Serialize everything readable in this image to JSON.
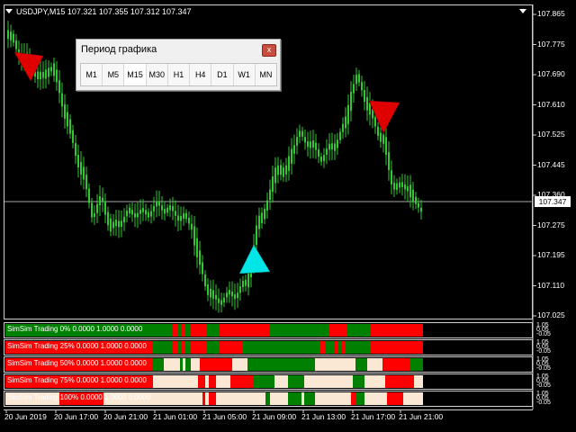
{
  "chart_header": "USDJPY,M15  107.321 107.355 107.312 107.347",
  "current_price": "107.347",
  "y_axis": {
    "labels": [
      "107.865",
      "107.775",
      "107.690",
      "107.610",
      "107.525",
      "107.445",
      "107.360",
      "107.275",
      "107.195",
      "107.110",
      "107.025"
    ]
  },
  "x_axis": {
    "labels": [
      "20 Jun 2019",
      "20 Jun 17:00",
      "20 Jun 21:00",
      "21 Jun 01:00",
      "21 Jun 05:00",
      "21 Jun 09:00",
      "21 Jun 13:00",
      "21 Jun 17:00",
      "21 Jun 21:00"
    ]
  },
  "timeframe_dialog": {
    "title": "Период графика",
    "close_label": "x",
    "buttons": [
      "M1",
      "M5",
      "M15",
      "M30",
      "H1",
      "H4",
      "D1",
      "W1",
      "MN"
    ],
    "selected": "M15"
  },
  "indicators": [
    {
      "label": "SimSim Trading 0% 0.0000 1.0000 0.0000"
    },
    {
      "label": "SimSim Trading 25% 0.0000 1.0000 0.0000"
    },
    {
      "label": "SimSim Trading 50% 0.0000 1.0000 0.0000"
    },
    {
      "label": "SimSim Trading 75% 0.0000 1.0000 0.0000"
    },
    {
      "label": "SimSim Trading 100% 0.0000 1.0000 0.0000"
    }
  ],
  "indicator_scale": [
    "1.05",
    "0.05",
    "-0.05"
  ],
  "colors": {
    "bull_candle": "#32c832",
    "background": "#000000",
    "buy_arrow": "#00e5e5",
    "sell_arrow": "#e00000",
    "ind_green": "#008000",
    "ind_red": "#ff0000",
    "ind_neutral": "#fbe8d4"
  },
  "icons": {
    "dropdown": "triangle-down-icon",
    "sell_signal": "red-arrow-icon",
    "buy_signal": "cyan-arrow-icon"
  }
}
